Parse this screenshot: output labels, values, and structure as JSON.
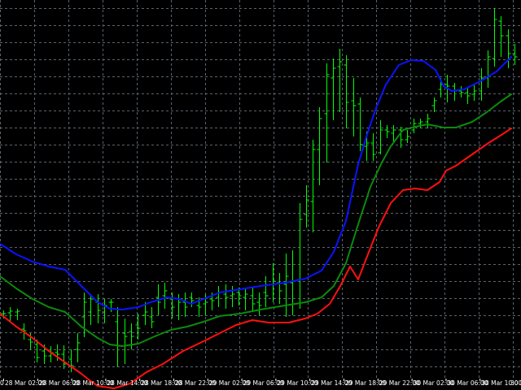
{
  "chart_data": {
    "type": "line",
    "title": "",
    "xlabel": "",
    "ylabel": "",
    "grid": true,
    "colors": {
      "background": "#000000",
      "grid": "#5a6470",
      "bars": "#00ff00",
      "upper_band": "#0a14ff",
      "middle_band": "#0c8a0c",
      "lower_band": "#ff1010",
      "text": "#ffffff"
    },
    "x_tick_labels": [
      "28 Mar 02:00",
      "28 Mar 06:00",
      "28 Mar 10:00",
      "28 Mar 14:00",
      "28 Mar 18:00",
      "28 Mar 22:00",
      "29 Mar 02:00",
      "29 Mar 06:00",
      "29 Mar 10:00",
      "29 Mar 14:00",
      "29 Mar 18:00",
      "29 Mar 22:00",
      "30 Mar 02:00",
      "30 Mar 06:00",
      "30 Mar 10:00"
    ],
    "edge_labels": {
      "left": "0",
      "right": "30 M"
    },
    "ohlc": [
      {
        "h": 382,
        "l": 392,
        "o": 386,
        "c": 386
      },
      {
        "h": 378,
        "l": 396,
        "o": 385,
        "c": 383
      },
      {
        "h": 380,
        "l": 394,
        "o": 384,
        "c": 383
      },
      {
        "h": 398,
        "l": 418,
        "o": 405,
        "c": 407
      },
      {
        "h": 410,
        "l": 430,
        "o": 418,
        "c": 421
      },
      {
        "h": 418,
        "l": 446,
        "o": 424,
        "c": 440
      },
      {
        "h": 424,
        "l": 448,
        "o": 432,
        "c": 438
      },
      {
        "h": 426,
        "l": 446,
        "o": 438,
        "c": 434
      },
      {
        "h": 424,
        "l": 444,
        "o": 434,
        "c": 436
      },
      {
        "h": 425,
        "l": 454,
        "o": 436,
        "c": 448
      },
      {
        "h": 430,
        "l": 458,
        "o": 442,
        "c": 450
      },
      {
        "h": 410,
        "l": 446,
        "o": 430,
        "c": 422
      },
      {
        "h": 360,
        "l": 415,
        "o": 390,
        "c": 372
      },
      {
        "h": 362,
        "l": 400,
        "o": 384,
        "c": 368
      },
      {
        "h": 362,
        "l": 398,
        "o": 372,
        "c": 382
      },
      {
        "h": 368,
        "l": 398,
        "o": 384,
        "c": 376
      },
      {
        "h": 368,
        "l": 384,
        "o": 372,
        "c": 372
      },
      {
        "h": 378,
        "l": 452,
        "o": 396,
        "c": 426
      },
      {
        "h": 392,
        "l": 448,
        "o": 410,
        "c": 414
      },
      {
        "h": 398,
        "l": 430,
        "o": 408,
        "c": 414
      },
      {
        "h": 386,
        "l": 418,
        "o": 400,
        "c": 404
      },
      {
        "h": 372,
        "l": 400,
        "o": 388,
        "c": 384
      },
      {
        "h": 378,
        "l": 404,
        "o": 390,
        "c": 396
      },
      {
        "h": 350,
        "l": 388,
        "o": 366,
        "c": 372
      },
      {
        "h": 348,
        "l": 380,
        "o": 364,
        "c": 358
      },
      {
        "h": 360,
        "l": 392,
        "o": 368,
        "c": 378
      },
      {
        "h": 362,
        "l": 394,
        "o": 368,
        "c": 372
      },
      {
        "h": 360,
        "l": 390,
        "o": 372,
        "c": 378
      },
      {
        "h": 360,
        "l": 378,
        "o": 366,
        "c": 370
      },
      {
        "h": 366,
        "l": 390,
        "o": 376,
        "c": 378
      },
      {
        "h": 362,
        "l": 388,
        "o": 374,
        "c": 372
      },
      {
        "h": 360,
        "l": 382,
        "o": 368,
        "c": 370
      },
      {
        "h": 352,
        "l": 378,
        "o": 366,
        "c": 360
      },
      {
        "h": 350,
        "l": 380,
        "o": 362,
        "c": 366
      },
      {
        "h": 352,
        "l": 378,
        "o": 364,
        "c": 362
      },
      {
        "h": 354,
        "l": 376,
        "o": 360,
        "c": 364
      },
      {
        "h": 356,
        "l": 382,
        "o": 366,
        "c": 362
      },
      {
        "h": 354,
        "l": 384,
        "o": 364,
        "c": 374
      },
      {
        "h": 360,
        "l": 388,
        "o": 372,
        "c": 376
      },
      {
        "h": 340,
        "l": 378,
        "o": 360,
        "c": 364
      },
      {
        "h": 324,
        "l": 372,
        "o": 350,
        "c": 346
      },
      {
        "h": 336,
        "l": 374,
        "o": 348,
        "c": 358
      },
      {
        "h": 312,
        "l": 390,
        "o": 350,
        "c": 340
      },
      {
        "h": 308,
        "l": 388,
        "o": 348,
        "c": 346
      },
      {
        "h": 250,
        "l": 380,
        "o": 344,
        "c": 270
      },
      {
        "h": 228,
        "l": 280,
        "o": 264,
        "c": 246
      },
      {
        "h": 172,
        "l": 286,
        "o": 248,
        "c": 184
      },
      {
        "h": 132,
        "l": 228,
        "o": 184,
        "c": 146
      },
      {
        "h": 78,
        "l": 200,
        "o": 140,
        "c": 92
      },
      {
        "h": 72,
        "l": 148,
        "o": 96,
        "c": 84
      },
      {
        "h": 60,
        "l": 138,
        "o": 82,
        "c": 76
      },
      {
        "h": 68,
        "l": 158,
        "o": 80,
        "c": 126
      },
      {
        "h": 96,
        "l": 168,
        "o": 124,
        "c": 130
      },
      {
        "h": 120,
        "l": 186,
        "o": 128,
        "c": 178
      },
      {
        "h": 162,
        "l": 198,
        "o": 180,
        "c": 176
      },
      {
        "h": 164,
        "l": 198,
        "o": 176,
        "c": 190
      },
      {
        "h": 148,
        "l": 190,
        "o": 188,
        "c": 160
      },
      {
        "h": 154,
        "l": 170,
        "o": 160,
        "c": 162
      },
      {
        "h": 154,
        "l": 176,
        "o": 164,
        "c": 160
      },
      {
        "h": 156,
        "l": 182,
        "o": 160,
        "c": 172
      },
      {
        "h": 160,
        "l": 176,
        "o": 172,
        "c": 168
      },
      {
        "h": 146,
        "l": 164,
        "o": 160,
        "c": 152
      },
      {
        "h": 146,
        "l": 158,
        "o": 152,
        "c": 150
      },
      {
        "h": 140,
        "l": 158,
        "o": 150,
        "c": 146
      },
      {
        "h": 120,
        "l": 138,
        "o": 130,
        "c": 124
      },
      {
        "h": 96,
        "l": 120,
        "o": 110,
        "c": 104
      },
      {
        "h": 92,
        "l": 126,
        "o": 104,
        "c": 106
      },
      {
        "h": 102,
        "l": 124,
        "o": 106,
        "c": 112
      },
      {
        "h": 106,
        "l": 120,
        "o": 112,
        "c": 114
      },
      {
        "h": 108,
        "l": 128,
        "o": 114,
        "c": 118
      },
      {
        "h": 104,
        "l": 124,
        "o": 116,
        "c": 112
      },
      {
        "h": 84,
        "l": 124,
        "o": 112,
        "c": 96
      },
      {
        "h": 62,
        "l": 108,
        "o": 96,
        "c": 70
      },
      {
        "h": 10,
        "l": 82,
        "o": 72,
        "c": 24
      },
      {
        "h": 20,
        "l": 70,
        "o": 26,
        "c": 44
      },
      {
        "h": 36,
        "l": 84,
        "o": 44,
        "c": 66
      },
      {
        "h": 54,
        "l": 80,
        "o": 66,
        "c": 70
      }
    ],
    "series": [
      {
        "values": [
          [
            0,
            300
          ],
          [
            20,
            313
          ],
          [
            40,
            322
          ],
          [
            60,
            328
          ],
          [
            80,
            332
          ],
          [
            100,
            352
          ],
          [
            120,
            372
          ],
          [
            135,
            380
          ],
          [
            150,
            381
          ],
          [
            170,
            378
          ],
          [
            185,
            372
          ],
          [
            205,
            366
          ],
          [
            220,
            368
          ],
          [
            235,
            374
          ],
          [
            250,
            368
          ],
          [
            270,
            360
          ],
          [
            295,
            356
          ],
          [
            320,
            352
          ],
          [
            350,
            348
          ],
          [
            375,
            343
          ],
          [
            395,
            333
          ],
          [
            410,
            310
          ],
          [
            425,
            272
          ],
          [
            440,
            202
          ],
          [
            452,
            162
          ],
          [
            462,
            133
          ],
          [
            474,
            104
          ],
          [
            490,
            80
          ],
          [
            505,
            74
          ],
          [
            520,
            75
          ],
          [
            535,
            86
          ],
          [
            545,
            106
          ],
          [
            555,
            112
          ],
          [
            570,
            110
          ],
          [
            590,
            100
          ],
          [
            610,
            88
          ],
          [
            628,
            70
          ]
        ]
      },
      {
        "values": [
          [
            0,
            340
          ],
          [
            20,
            355
          ],
          [
            40,
            368
          ],
          [
            60,
            378
          ],
          [
            80,
            384
          ],
          [
            100,
            402
          ],
          [
            120,
            416
          ],
          [
            135,
            424
          ],
          [
            150,
            426
          ],
          [
            170,
            423
          ],
          [
            190,
            414
          ],
          [
            210,
            406
          ],
          [
            230,
            402
          ],
          [
            250,
            396
          ],
          [
            270,
            389
          ],
          [
            295,
            386
          ],
          [
            320,
            381
          ],
          [
            350,
            376
          ],
          [
            375,
            372
          ],
          [
            395,
            366
          ],
          [
            410,
            352
          ],
          [
            425,
            324
          ],
          [
            440,
            276
          ],
          [
            455,
            230
          ],
          [
            468,
            202
          ],
          [
            480,
            180
          ],
          [
            495,
            160
          ],
          [
            510,
            156
          ],
          [
            525,
            153
          ],
          [
            545,
            157
          ],
          [
            560,
            157
          ],
          [
            580,
            150
          ],
          [
            598,
            138
          ],
          [
            615,
            125
          ],
          [
            628,
            116
          ]
        ]
      },
      {
        "values": [
          [
            0,
            386
          ],
          [
            20,
            402
          ],
          [
            40,
            416
          ],
          [
            60,
            432
          ],
          [
            80,
            446
          ],
          [
            100,
            460
          ],
          [
            110,
            468
          ],
          [
            120,
            475
          ],
          [
            140,
            478
          ],
          [
            160,
            472
          ],
          [
            180,
            458
          ],
          [
            200,
            448
          ],
          [
            225,
            432
          ],
          [
            250,
            420
          ],
          [
            270,
            410
          ],
          [
            290,
            400
          ],
          [
            310,
            394
          ],
          [
            330,
            397
          ],
          [
            355,
            397
          ],
          [
            375,
            392
          ],
          [
            390,
            386
          ],
          [
            405,
            374
          ],
          [
            418,
            352
          ],
          [
            430,
            328
          ],
          [
            440,
            344
          ],
          [
            450,
            318
          ],
          [
            465,
            280
          ],
          [
            480,
            250
          ],
          [
            495,
            234
          ],
          [
            510,
            232
          ],
          [
            525,
            234
          ],
          [
            540,
            224
          ],
          [
            548,
            210
          ],
          [
            560,
            204
          ],
          [
            580,
            190
          ],
          [
            600,
            176
          ],
          [
            616,
            166
          ],
          [
            628,
            158
          ]
        ]
      }
    ]
  }
}
